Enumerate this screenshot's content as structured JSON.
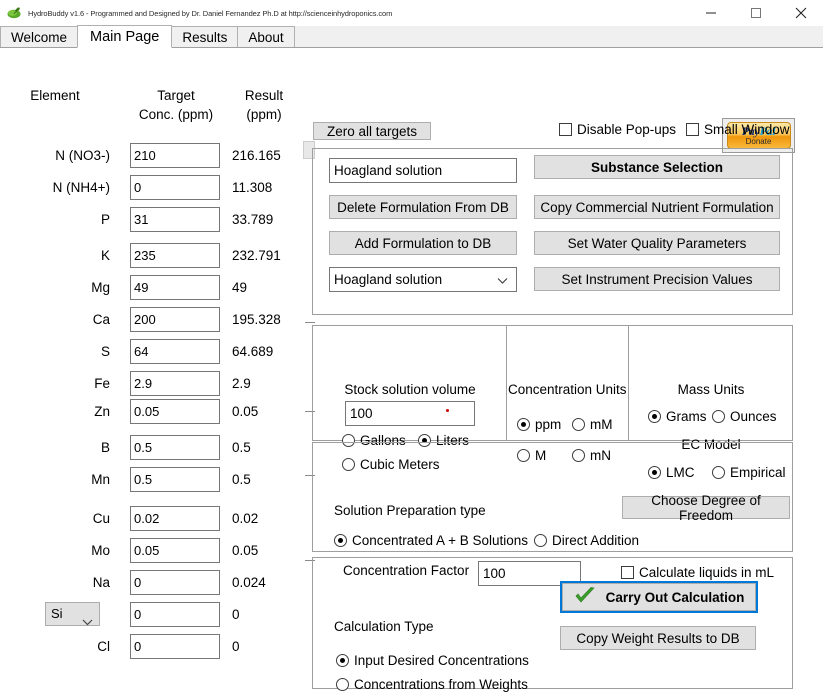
{
  "window": {
    "title": "HydroBuddy v1.6 - Programmed and Designed by Dr. Daniel Fernandez Ph.D at http://scienceinhydroponics.com",
    "app_icon": "plant-leaf-icon",
    "minimize": "—",
    "maximize": "□",
    "close": "✕"
  },
  "tabs": [
    {
      "label": "Welcome",
      "active": false
    },
    {
      "label": "Main Page",
      "active": true
    },
    {
      "label": "Results",
      "active": false
    },
    {
      "label": "About",
      "active": false
    }
  ],
  "grid": {
    "headers": {
      "element": "Element",
      "target_line1": "Target",
      "target_line2": "Conc. (ppm)",
      "result_line1": "Result",
      "result_line2": "(ppm)"
    },
    "rows": [
      {
        "label": "N (NO3-)",
        "target": "210",
        "result": "216.165",
        "combo": false
      },
      {
        "label": "N (NH4+)",
        "target": "0",
        "result": "11.308",
        "combo": false
      },
      {
        "label": "P",
        "target": "31",
        "result": "33.789",
        "combo": false
      },
      {
        "label": "K",
        "target": "235",
        "result": "232.791",
        "combo": false
      },
      {
        "label": "Mg",
        "target": "49",
        "result": "49",
        "combo": false
      },
      {
        "label": "Ca",
        "target": "200",
        "result": "195.328",
        "combo": false
      },
      {
        "label": "S",
        "target": "64",
        "result": "64.689",
        "combo": false
      },
      {
        "label": "Fe",
        "target": "2.9",
        "result": "2.9",
        "combo": false
      },
      {
        "label": "Zn",
        "target": "0.05",
        "result": "0.05",
        "combo": false
      },
      {
        "label": "B",
        "target": "0.5",
        "result": "0.5",
        "combo": false
      },
      {
        "label": "Mn",
        "target": "0.5",
        "result": "0.5",
        "combo": false
      },
      {
        "label": "Cu",
        "target": "0.02",
        "result": "0.02",
        "combo": false
      },
      {
        "label": "Mo",
        "target": "0.05",
        "result": "0.05",
        "combo": false
      },
      {
        "label": "Na",
        "target": "0",
        "result": "0.024",
        "combo": false
      },
      {
        "label": "Si",
        "target": "0",
        "result": "0",
        "combo": true
      },
      {
        "label": "Cl",
        "target": "0",
        "result": "0",
        "combo": false
      }
    ]
  },
  "toolbar": {
    "zero_all_targets": "Zero all targets",
    "disable_popups": {
      "label": "Disable Pop-ups",
      "checked": false
    },
    "small_window": {
      "label": "Small Window",
      "checked": false
    },
    "paypal": {
      "brand_pay": "Pay",
      "brand_pal": "Pal",
      "donate": "Donate"
    }
  },
  "formulation": {
    "name_value": "Hoagland solution",
    "delete_from_db": "Delete Formulation From DB",
    "add_to_db": "Add Formulation to DB",
    "selected_formulation": "Hoagland solution",
    "substance_selection": "Substance Selection",
    "copy_commercial": "Copy Commercial Nutrient Formulation",
    "set_water_quality": "Set Water Quality Parameters",
    "set_precision": "Set Instrument Precision Values"
  },
  "stock": {
    "title": "Stock solution volume",
    "volume_value": "100",
    "units": [
      {
        "label": "Gallons",
        "selected": false
      },
      {
        "label": "Liters",
        "selected": true
      },
      {
        "label": "Cubic Meters",
        "selected": false
      }
    ]
  },
  "conc_units": {
    "title": "Concentration Units",
    "options": [
      {
        "label": "ppm",
        "selected": true
      },
      {
        "label": "mM",
        "selected": false
      },
      {
        "label": "M",
        "selected": false
      },
      {
        "label": "mN",
        "selected": false
      }
    ]
  },
  "mass_units": {
    "title": "Mass Units",
    "options": [
      {
        "label": "Grams",
        "selected": true
      },
      {
        "label": "Ounces",
        "selected": false
      }
    ]
  },
  "ec_model": {
    "title": "EC Model",
    "options": [
      {
        "label": "LMC",
        "selected": true
      },
      {
        "label": "Empirical",
        "selected": false
      }
    ]
  },
  "preparation": {
    "title": "Solution Preparation type",
    "options": [
      {
        "label": "Concentrated A + B Solutions",
        "selected": true
      },
      {
        "label": "Direct Addition",
        "selected": false
      }
    ],
    "factor_label": "Concentration Factor",
    "factor_value": "100",
    "calc_liquids": {
      "label": "Calculate liquids in mL",
      "checked": false
    },
    "degree_of_freedom": "Choose Degree of Freedom"
  },
  "calculation": {
    "title": "Calculation Type",
    "options": [
      {
        "label": "Input Desired Concentrations",
        "selected": true
      },
      {
        "label": "Concentrations from  Weights",
        "selected": false
      }
    ],
    "carry_out": "Carry Out Calculation",
    "copy_weights": "Copy Weight Results to DB"
  },
  "colors": {
    "accent": "#0078d7",
    "button_face": "#e1e1e1",
    "check_green": "#39a02a",
    "paypal_orange": "#f0960a",
    "marker_red": "#d00000"
  }
}
